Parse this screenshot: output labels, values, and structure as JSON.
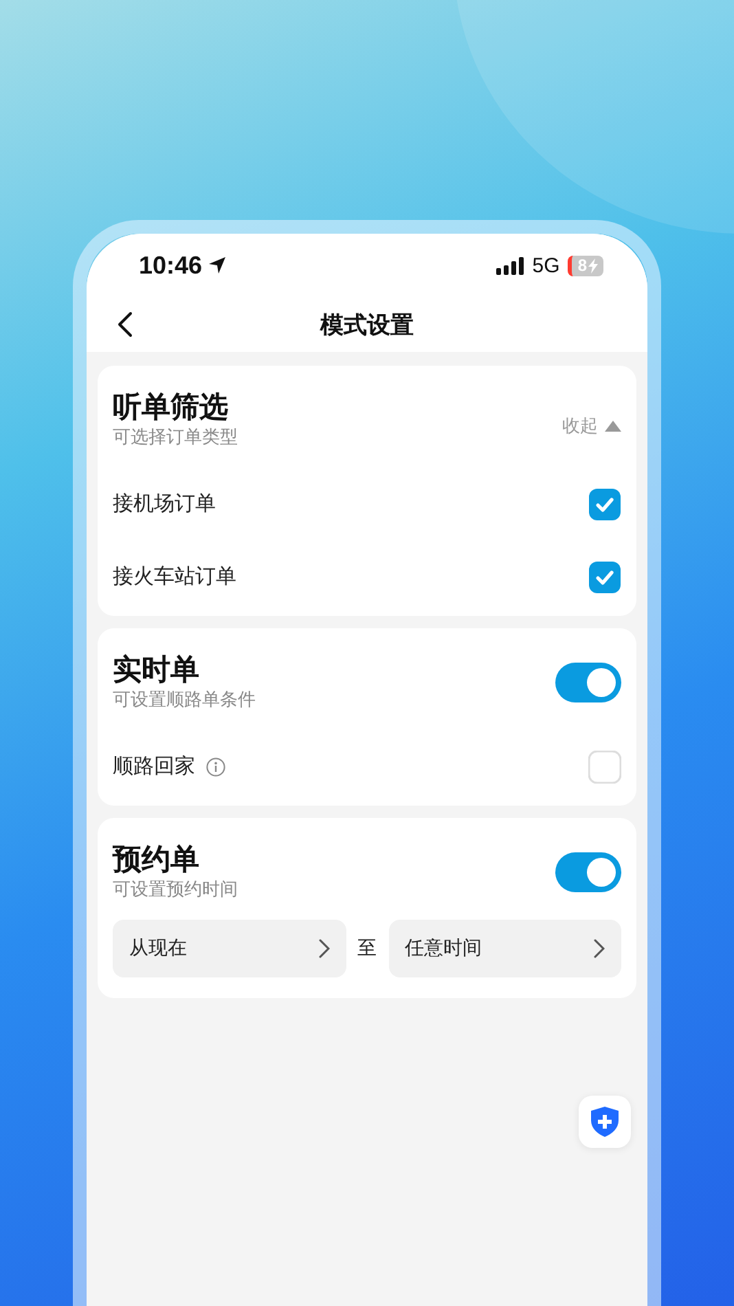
{
  "status_bar": {
    "time": "10:46",
    "network": "5G",
    "battery": "8"
  },
  "nav": {
    "title": "模式设置"
  },
  "sections": [
    {
      "title": "听单筛选",
      "subtitle": "可选择订单类型",
      "collapse_label": "收起",
      "expanded": true,
      "items": [
        {
          "label": "接机场订单",
          "checked": true,
          "info": false
        },
        {
          "label": "接火车站订单",
          "checked": true,
          "info": false
        }
      ]
    },
    {
      "title": "实时单",
      "subtitle": "可设置顺路单条件",
      "on": true,
      "items": [
        {
          "label": "顺路回家",
          "checked": false,
          "info": true
        }
      ]
    },
    {
      "title": "预约单",
      "subtitle": "可设置预约时间",
      "on": true,
      "range": {
        "from": "从现在",
        "separator": "至",
        "to": "任意时间"
      }
    }
  ]
}
